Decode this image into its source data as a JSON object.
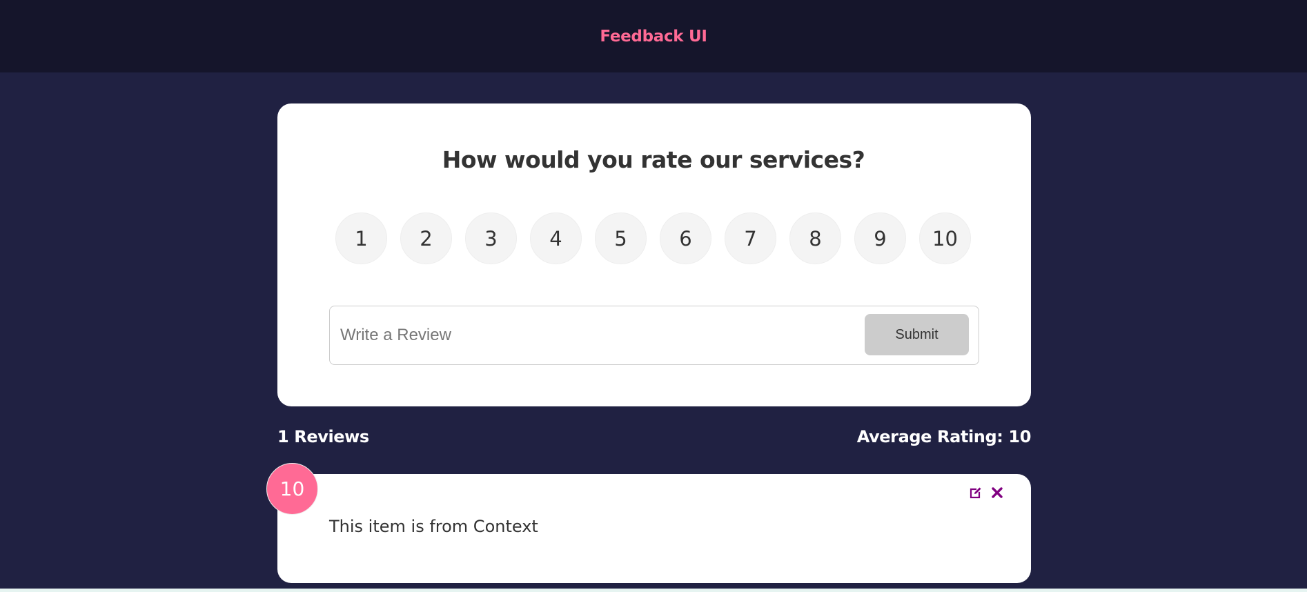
{
  "header": {
    "title": "Feedback UI"
  },
  "rating_card": {
    "question": "How would you rate our services?",
    "options": [
      "1",
      "2",
      "3",
      "4",
      "5",
      "6",
      "7",
      "8",
      "9",
      "10"
    ],
    "review_input": {
      "placeholder": "Write a Review",
      "value": ""
    },
    "submit_label": "Submit"
  },
  "stats": {
    "review_count": "1 Reviews",
    "average_rating": "Average Rating: 10"
  },
  "reviews": [
    {
      "rating": "10",
      "text": "This item is from Context",
      "actions": [
        "edit-icon",
        "close-icon"
      ]
    }
  ],
  "colors": {
    "page_background": "#202142",
    "header_background": "#15152b",
    "brand_pink": "#ff6a95",
    "icon_purple": "#800080",
    "submit_disabled": "#cccccc"
  }
}
